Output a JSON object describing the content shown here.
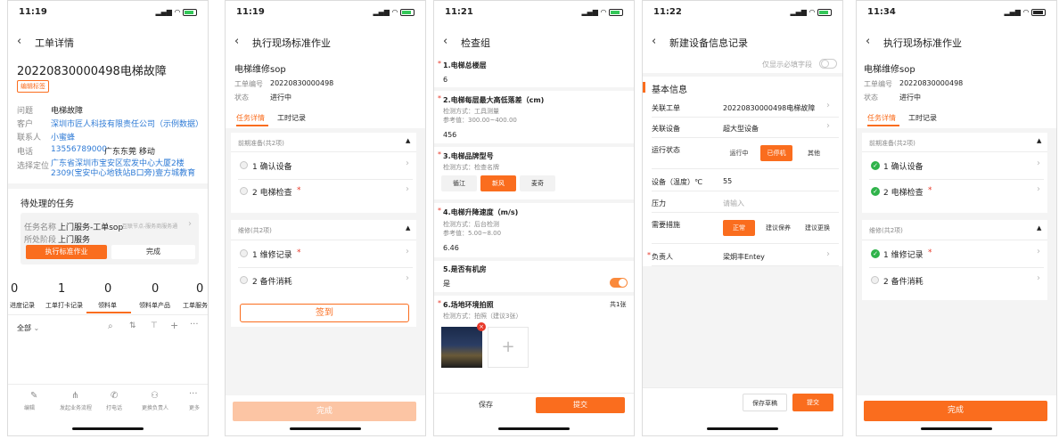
{
  "screens": [
    {
      "status_time": "11:19",
      "nav_title": "工单详情",
      "ticket_title": "20220830000498电梯故障",
      "tag": "编辑标签",
      "fields": [
        {
          "label": "问题",
          "value": "电梯故障"
        },
        {
          "label": "客户",
          "value": "深圳市匠人科技有限责任公司（示例数据）"
        },
        {
          "label": "联系人",
          "value": "小蜜蜂"
        },
        {
          "label": "电话",
          "value": "13556789000",
          "extra": "广东东莞 移动"
        },
        {
          "label": "选择定位",
          "value": "广东省深圳市宝安区宏发中心大厦2楼2309(宝安中心地铁站B口旁)壹方城教育"
        }
      ],
      "pending_title": "待处理的任务",
      "task_name_label": "任务名称",
      "task_name": "上门服务-工单sop",
      "task_hint": "互联节点-服务商服务通",
      "stage_label": "所处阶段",
      "stage": "上门服务",
      "execute_btn": "执行标准作业",
      "complete_btn": "完成",
      "stats": [
        {
          "value": "0",
          "label": "进度记录"
        },
        {
          "value": "1",
          "label": "工单打卡记录"
        },
        {
          "value": "0",
          "label": "领料单"
        },
        {
          "value": "0",
          "label": "领料单产品"
        },
        {
          "value": "0",
          "label": "工单服务"
        }
      ],
      "filter_all": "全部",
      "bottom_nav": [
        "编辑",
        "发起业务流程",
        "打电话",
        "更换负责人",
        "更多"
      ]
    },
    {
      "status_time": "11:19",
      "nav_title": "执行现场标准作业",
      "sop_title": "电梯维修sop",
      "order_no_label": "工单编号",
      "order_no": "20220830000498",
      "status_label": "状态",
      "status": "进行中",
      "tabs": [
        "任务详情",
        "工时记录"
      ],
      "group1": "前期准备(共2项)",
      "group1_items": [
        "1 确认设备",
        "2 电梯检查"
      ],
      "group2": "维修(共2项)",
      "group2_items": [
        "1 维修记录",
        "2 备件消耗"
      ],
      "sign_btn": "签到",
      "complete_btn": "完成"
    },
    {
      "status_time": "11:21",
      "nav_title": "检查组",
      "q1_label": "1.电梯总楼层",
      "q1_value": "6",
      "q2_label": "2.电梯每层最大高低落差（cm)",
      "q2_method": "检测方式：工具测量",
      "q2_ref": "参考值：300.00~400.00",
      "q2_value": "456",
      "q3_label": "3.电梯品牌型号",
      "q3_method": "检测方式：检查名牌",
      "q3_options": [
        "循江",
        "新风",
        "麦奇"
      ],
      "q4_label": "4.电梯升降速度（m/s)",
      "q4_method": "检测方式：后台检测",
      "q4_ref": "参考值：5.00~8.00",
      "q4_value": "6.46",
      "q5_label": "5.是否有机房",
      "q5_value": "是",
      "q6_label": "6.场地环境拍照",
      "q6_count": "共1张",
      "q6_method": "检测方式：拍照（建议3张）",
      "save_btn": "保存",
      "submit_btn": "提交"
    },
    {
      "status_time": "11:22",
      "nav_title": "新建设备信息记录",
      "required_toggle": "仅显示必填字段",
      "section": "基本信息",
      "related_order_label": "关联工单",
      "related_order": "20220830000498电梯故障",
      "related_device_label": "关联设备",
      "related_device": "超大型设备",
      "run_status_label": "运行状态",
      "run_status_options": [
        "运行中",
        "已停机",
        "其他"
      ],
      "temp_label": "设备（温度）℃",
      "temp_value": "55",
      "pressure_label": "压力",
      "pressure_placeholder": "请输入",
      "measure_label": "需要措施",
      "measure_options": [
        "正常",
        "建议保养",
        "建议更换"
      ],
      "owner_label": "负责人",
      "owner": "梁炯丰Entey",
      "draft_btn": "保存草稿",
      "submit_btn": "提交"
    },
    {
      "status_time": "11:34",
      "nav_title": "执行现场标准作业",
      "sop_title": "电梯维修sop",
      "order_no_label": "工单编号",
      "order_no": "20220830000498",
      "status_label": "状态",
      "status": "进行中",
      "tabs": [
        "任务详情",
        "工时记录"
      ],
      "group1": "前期准备(共2项)",
      "group1_items": [
        "1 确认设备",
        "2 电梯检查"
      ],
      "group2": "维修(共2项)",
      "group2_items": [
        "1 维修记录",
        "2 备件消耗"
      ],
      "complete_btn": "完成"
    }
  ],
  "colors": {
    "accent": "#fa6d1e",
    "link": "#2f7bd6",
    "success": "#2fb34a",
    "required": "#e8392a"
  }
}
